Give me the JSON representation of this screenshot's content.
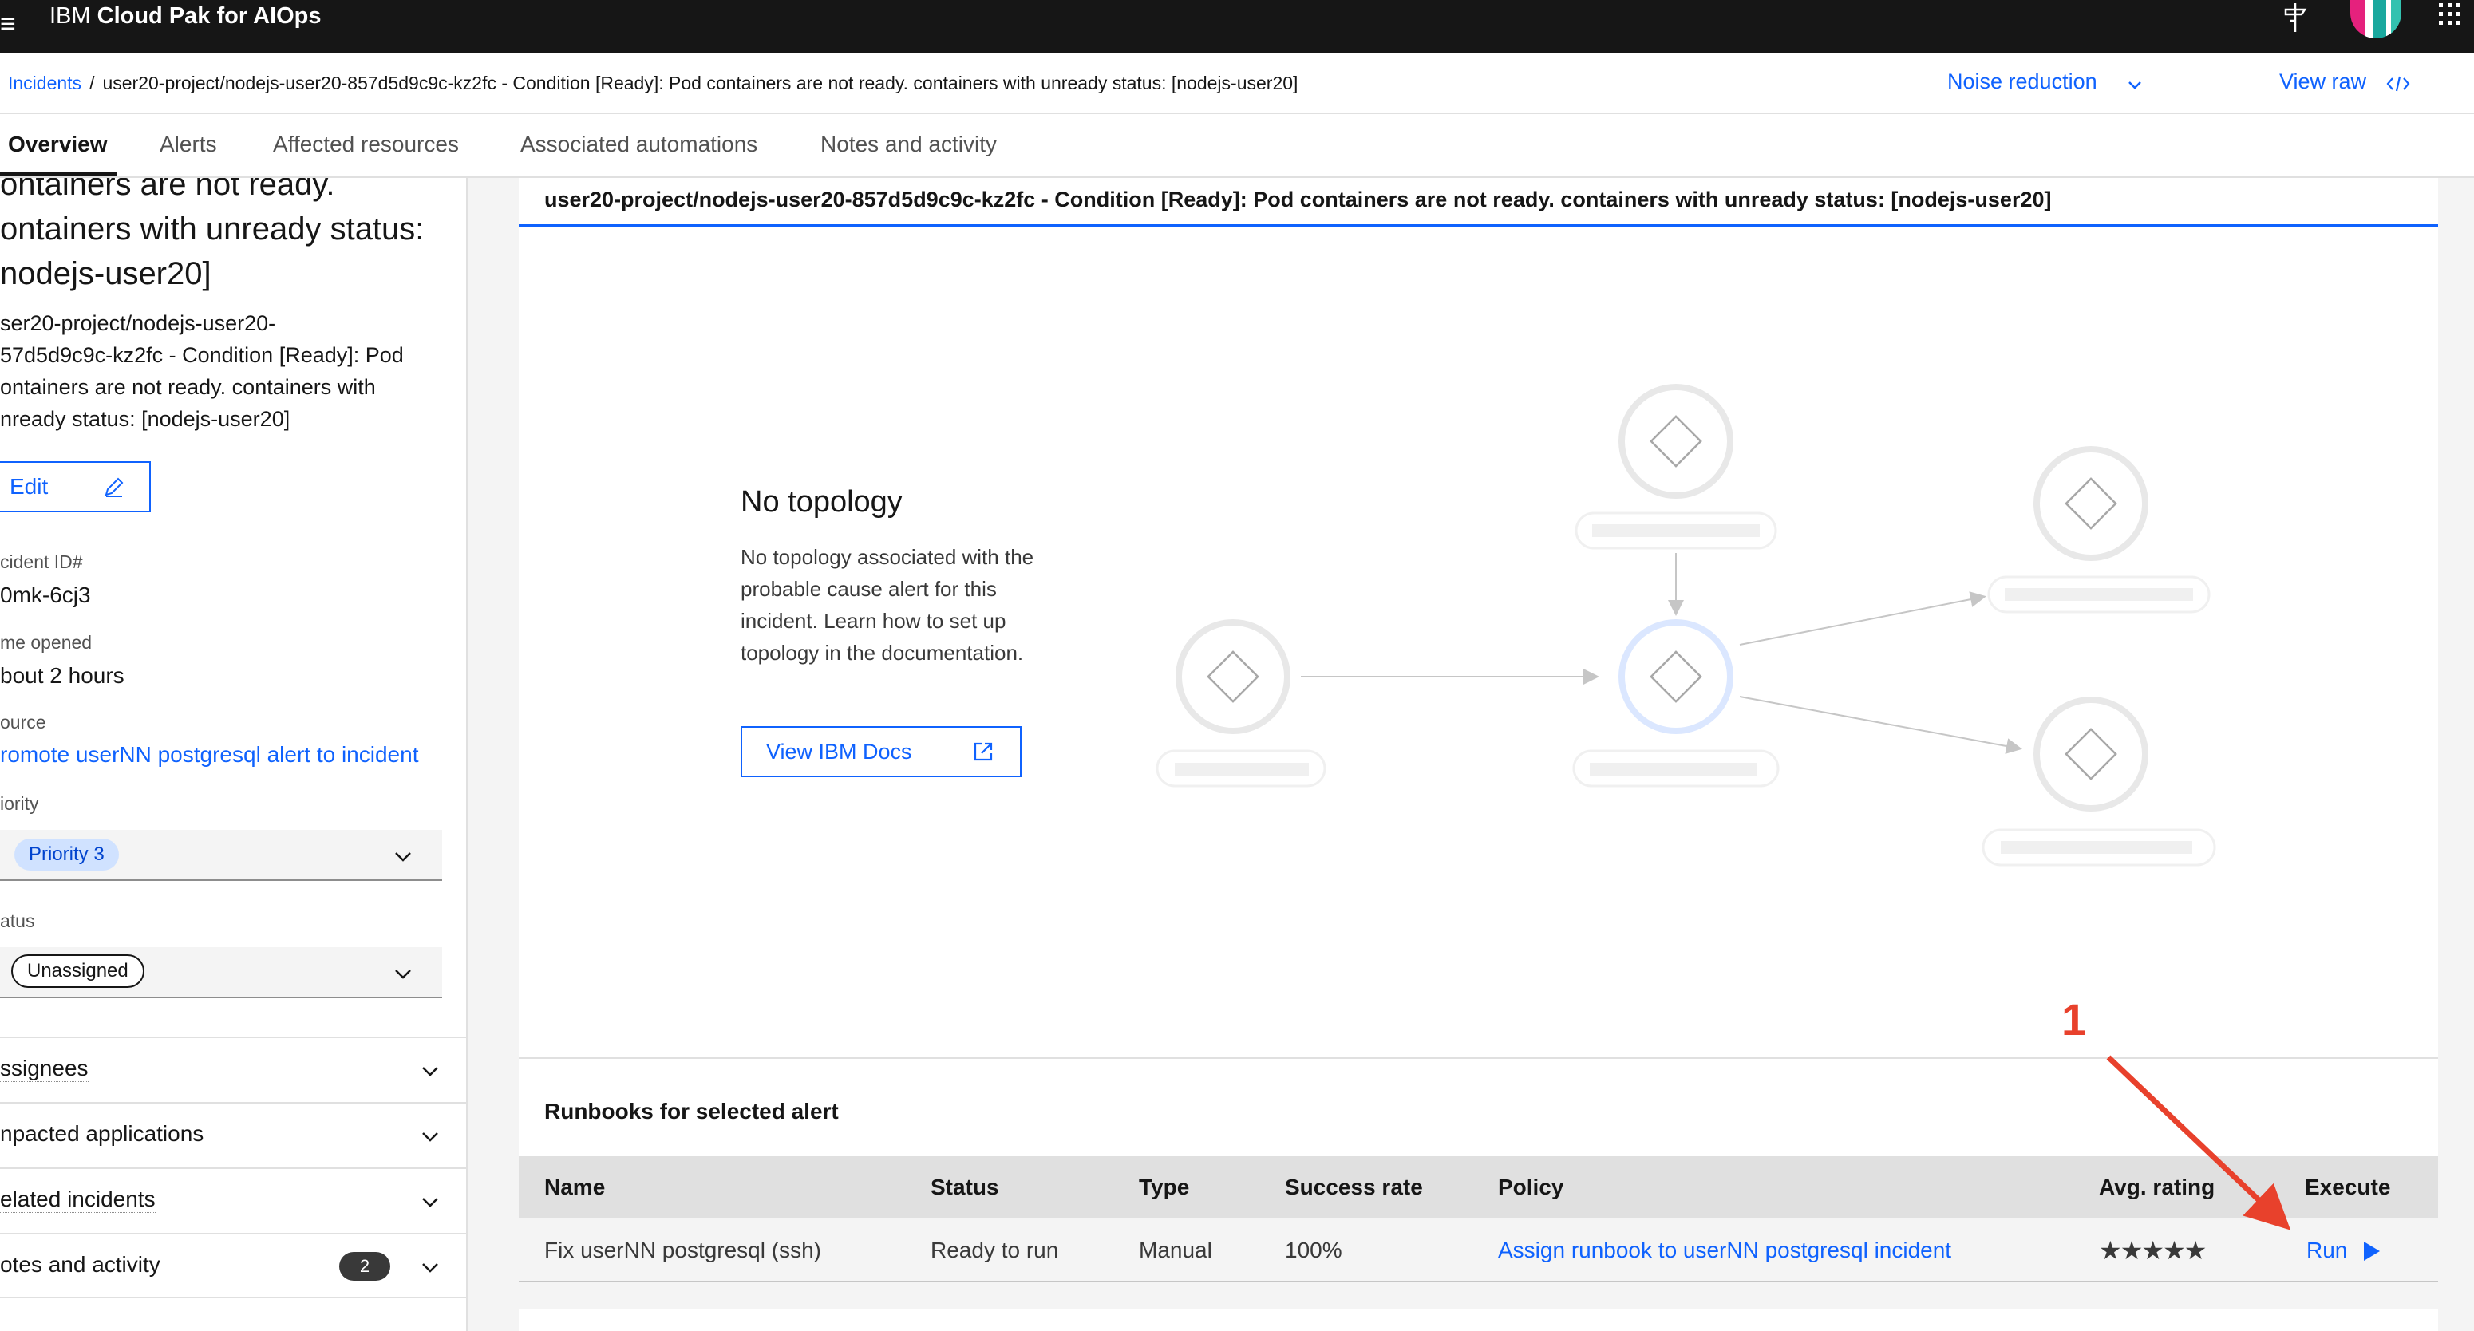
{
  "header": {
    "brand_prefix": "IBM",
    "brand_name": "Cloud Pak for AIOps"
  },
  "breadcrumb": {
    "root": "Incidents",
    "separator": "/",
    "current": "user20-project/nodejs-user20-857d5d9c9c-kz2fc - Condition [Ready]: Pod containers are not ready. containers with unready status: [nodejs-user20]"
  },
  "toolbar": {
    "noise_reduction": "Noise reduction",
    "view_raw": "View raw"
  },
  "tabs": [
    {
      "label": "Overview"
    },
    {
      "label": "Alerts"
    },
    {
      "label": "Affected resources"
    },
    {
      "label": "Associated automations"
    },
    {
      "label": "Notes and activity"
    }
  ],
  "incident": {
    "title_lines": [
      "ontainers are not ready.",
      "ontainers with unready status:",
      "nodejs-user20]"
    ],
    "description_lines": [
      "ser20-project/nodejs-user20-",
      "57d5d9c9c-kz2fc - Condition [Ready]: Pod",
      "ontainers are not ready. containers with",
      "nready status: [nodejs-user20]"
    ],
    "edit_label": "Edit",
    "id_label": "cident ID#",
    "id_value": "0mk-6cj3",
    "time_label": "me opened",
    "time_value": "bout 2 hours",
    "source_label": "ource",
    "source_value": "romote userNN postgresql alert to incident",
    "priority_label": "iority",
    "priority_value": "Priority 3",
    "status_label": "atus",
    "status_value": "Unassigned"
  },
  "accordions": [
    {
      "label": "ssignees"
    },
    {
      "label": "npacted applications"
    },
    {
      "label": "elated incidents"
    },
    {
      "label": "otes and activity",
      "count": "2"
    }
  ],
  "alert": {
    "title": "user20-project/nodejs-user20-857d5d9c9c-kz2fc - Condition [Ready]: Pod containers are not ready. containers with unready status: [nodejs-user20]"
  },
  "topology": {
    "heading": "No topology",
    "body": "No topology associated with the probable cause alert for this incident. Learn how to set up topology in the documentation.",
    "docs_button": "View IBM Docs"
  },
  "runbooks": {
    "title": "Runbooks for selected alert",
    "columns": [
      "Name",
      "Status",
      "Type",
      "Success rate",
      "Policy",
      "Avg. rating",
      "Execute"
    ],
    "rows": [
      {
        "name": "Fix userNN postgresql (ssh)",
        "status": "Ready to run",
        "type": "Manual",
        "success_rate": "100%",
        "policy": "Assign runbook to userNN postgresql incident",
        "rating": 5,
        "execute": "Run"
      }
    ]
  },
  "annotation": {
    "number": "1",
    "color": "#e8412c"
  },
  "colors": {
    "accent": "#0f62fe",
    "header_bg": "#161616",
    "annotation": "#e8412c"
  }
}
